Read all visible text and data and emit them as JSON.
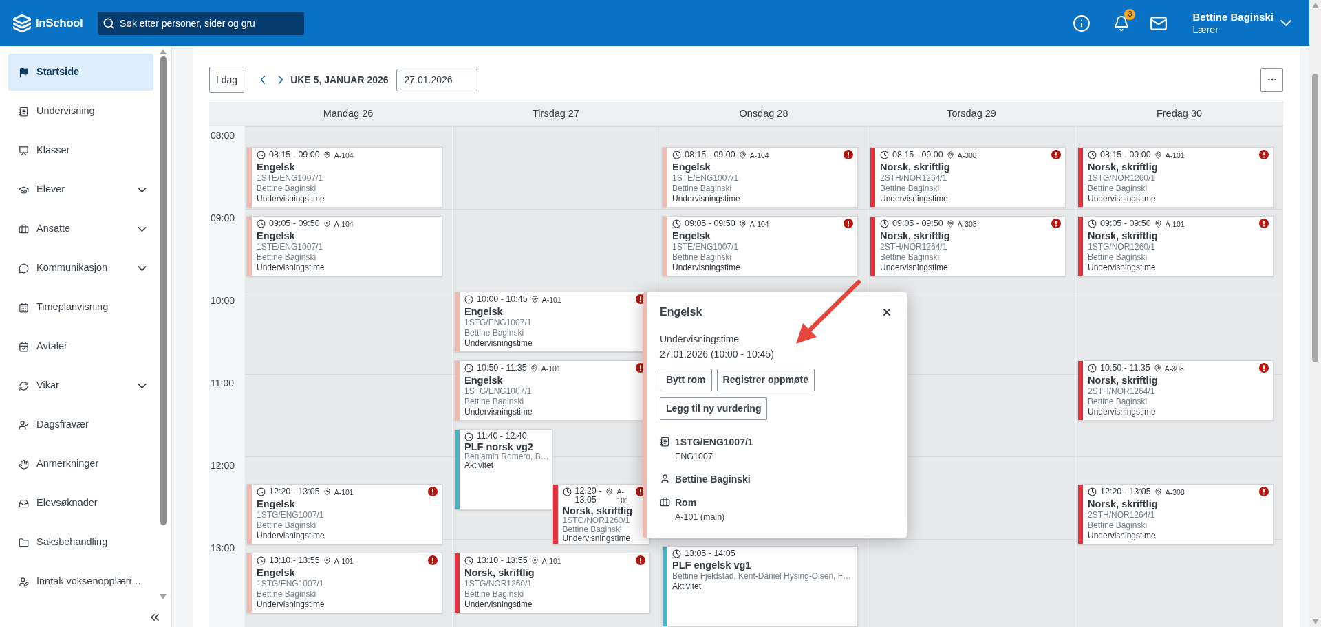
{
  "app": {
    "name": "InSchool"
  },
  "search": {
    "placeholder": "Søk etter personer, sider og gru"
  },
  "notifications": {
    "count": "3"
  },
  "user": {
    "name": "Bettine Baginski",
    "role": "Lærer"
  },
  "sidebar": {
    "items": [
      {
        "label": "Startside",
        "selected": true,
        "expandable": false
      },
      {
        "label": "Undervisning",
        "selected": false,
        "expandable": false
      },
      {
        "label": "Klasser",
        "selected": false,
        "expandable": false
      },
      {
        "label": "Elever",
        "selected": false,
        "expandable": true
      },
      {
        "label": "Ansatte",
        "selected": false,
        "expandable": true
      },
      {
        "label": "Kommunikasjon",
        "selected": false,
        "expandable": true
      },
      {
        "label": "Timeplanvisning",
        "selected": false,
        "expandable": false
      },
      {
        "label": "Avtaler",
        "selected": false,
        "expandable": false
      },
      {
        "label": "Vikar",
        "selected": false,
        "expandable": true
      },
      {
        "label": "Dagsfravær",
        "selected": false,
        "expandable": false
      },
      {
        "label": "Anmerkninger",
        "selected": false,
        "expandable": false
      },
      {
        "label": "Elevsøknader",
        "selected": false,
        "expandable": false
      },
      {
        "label": "Saksbehandling",
        "selected": false,
        "expandable": false
      },
      {
        "label": "Inntak voksenopplæri…",
        "selected": false,
        "expandable": false
      }
    ]
  },
  "toolbar": {
    "today": "I dag",
    "week_label": "UKE 5, JANUAR 2026",
    "date": "27.01.2026"
  },
  "calendar": {
    "hours": [
      "08:00",
      "09:00",
      "10:00",
      "11:00",
      "12:00",
      "13:00"
    ],
    "days": [
      {
        "label": "Mandag 26",
        "events": [
          {
            "time": "08:15 - 09:00",
            "room": "A-104",
            "title": "Engelsk",
            "group": "1STE/ENG1007/1",
            "teacher": "Bettine Baginski",
            "type": "Undervisningstime",
            "color": "#f2b8b0",
            "alert": false
          },
          {
            "time": "09:05 - 09:50",
            "room": "A-104",
            "title": "Engelsk",
            "group": "1STE/ENG1007/1",
            "teacher": "Bettine Baginski",
            "type": "Undervisningstime",
            "color": "#f2b8b0",
            "alert": false
          },
          {
            "time": "12:20 - 13:05",
            "room": "A-101",
            "title": "Engelsk",
            "group": "1STG/ENG1007/1",
            "teacher": "Bettine Baginski",
            "type": "Undervisningstime",
            "color": "#f2b8b0",
            "alert": true
          },
          {
            "time": "13:10 - 13:55",
            "room": "A-101",
            "title": "Engelsk",
            "group": "1STG/ENG1007/1",
            "teacher": "Bettine Baginski",
            "type": "Undervisningstime",
            "color": "#f2b8b0",
            "alert": true
          }
        ]
      },
      {
        "label": "Tirsdag 27",
        "events": [
          {
            "time": "10:00 - 10:45",
            "room": "A-101",
            "title": "Engelsk",
            "group": "1STG/ENG1007/1",
            "teacher": "Bettine Baginski",
            "type": "Undervisningstime",
            "color": "#f2b8b0",
            "alert": true
          },
          {
            "time": "10:50 - 11:35",
            "room": "A-101",
            "title": "Engelsk",
            "group": "1STG/ENG1007/1",
            "teacher": "Bettine Baginski",
            "type": "Undervisningstime",
            "color": "#f2b8b0",
            "alert": true
          },
          {
            "time": "11:40 - 12:40",
            "title": "PLF norsk vg2",
            "teacher": "Benjamin Romero, B…",
            "type": "Aktivitet",
            "color": "#4bb0c0",
            "alert": false
          },
          {
            "time": "12:20 - 13:05",
            "room": "A-101",
            "title": "Norsk, skriftlig",
            "group": "1STG/NOR1260/1",
            "teacher": "Bettine Baginski",
            "type": "Undervisningstime",
            "color": "#e8303a",
            "alert": true
          },
          {
            "time": "13:10 - 13:55",
            "room": "A-101",
            "title": "Norsk, skriftlig",
            "group": "1STG/NOR1260/1",
            "teacher": "Bettine Baginski",
            "type": "Undervisningstime",
            "color": "#e8303a",
            "alert": true
          }
        ]
      },
      {
        "label": "Onsdag 28",
        "events": [
          {
            "time": "08:15 - 09:00",
            "room": "A-104",
            "title": "Engelsk",
            "group": "1STE/ENG1007/1",
            "teacher": "Bettine Baginski",
            "type": "Undervisningstime",
            "color": "#f2b8b0",
            "alert": true
          },
          {
            "time": "09:05 - 09:50",
            "room": "A-104",
            "title": "Engelsk",
            "group": "1STE/ENG1007/1",
            "teacher": "Bettine Baginski",
            "type": "Undervisningstime",
            "color": "#f2b8b0",
            "alert": true
          },
          {
            "time": "13:05 - 14:05",
            "title": "PLF engelsk vg1",
            "teacher": "Bettine Fjeldstad, Kent-Daniel Hysing-Olsen, F…",
            "type": "Aktivitet",
            "color": "#4bb0c0",
            "alert": false
          }
        ]
      },
      {
        "label": "Torsdag 29",
        "events": [
          {
            "time": "08:15 - 09:00",
            "room": "A-308",
            "title": "Norsk, skriftlig",
            "group": "2STH/NOR1264/1",
            "teacher": "Bettine Baginski",
            "type": "Undervisningstime",
            "color": "#e8303a",
            "alert": true
          },
          {
            "time": "09:05 - 09:50",
            "room": "A-308",
            "title": "Norsk, skriftlig",
            "group": "2STH/NOR1264/1",
            "teacher": "Bettine Baginski",
            "type": "Undervisningstime",
            "color": "#e8303a",
            "alert": true
          }
        ]
      },
      {
        "label": "Fredag 30",
        "events": [
          {
            "time": "08:15 - 09:00",
            "room": "A-101",
            "title": "Norsk, skriftlig",
            "group": "1STG/NOR1260/1",
            "teacher": "Bettine Baginski",
            "type": "Undervisningstime",
            "color": "#e8303a",
            "alert": true
          },
          {
            "time": "09:05 - 09:50",
            "room": "A-101",
            "title": "Norsk, skriftlig",
            "group": "1STG/NOR1260/1",
            "teacher": "Bettine Baginski",
            "type": "Undervisningstime",
            "color": "#e8303a",
            "alert": true
          },
          {
            "time": "10:50 - 11:35",
            "room": "A-308",
            "title": "Norsk, skriftlig",
            "group": "2STH/NOR1264/1",
            "teacher": "Bettine Baginski",
            "type": "Undervisningstime",
            "color": "#e8303a",
            "alert": true
          },
          {
            "time": "12:20 - 13:05",
            "room": "A-308",
            "title": "Norsk, skriftlig",
            "group": "2STH/NOR1264/1",
            "teacher": "Bettine Baginski",
            "type": "Undervisningstime",
            "color": "#e8303a",
            "alert": true
          }
        ]
      }
    ]
  },
  "popup": {
    "title": "Engelsk",
    "type": "Undervisningstime",
    "when": "27.01.2026 (10:00 - 10:45)",
    "color": "#f2b8b0",
    "buttons": [
      "Bytt rom",
      "Registrer oppmøte",
      "Legg til ny vurdering"
    ],
    "details": [
      {
        "label": "1STG/ENG1007/1",
        "sub": "ENG1007"
      },
      {
        "label": "Bettine Baginski"
      },
      {
        "label": "Rom",
        "sub": "A-101 (main)"
      }
    ]
  }
}
